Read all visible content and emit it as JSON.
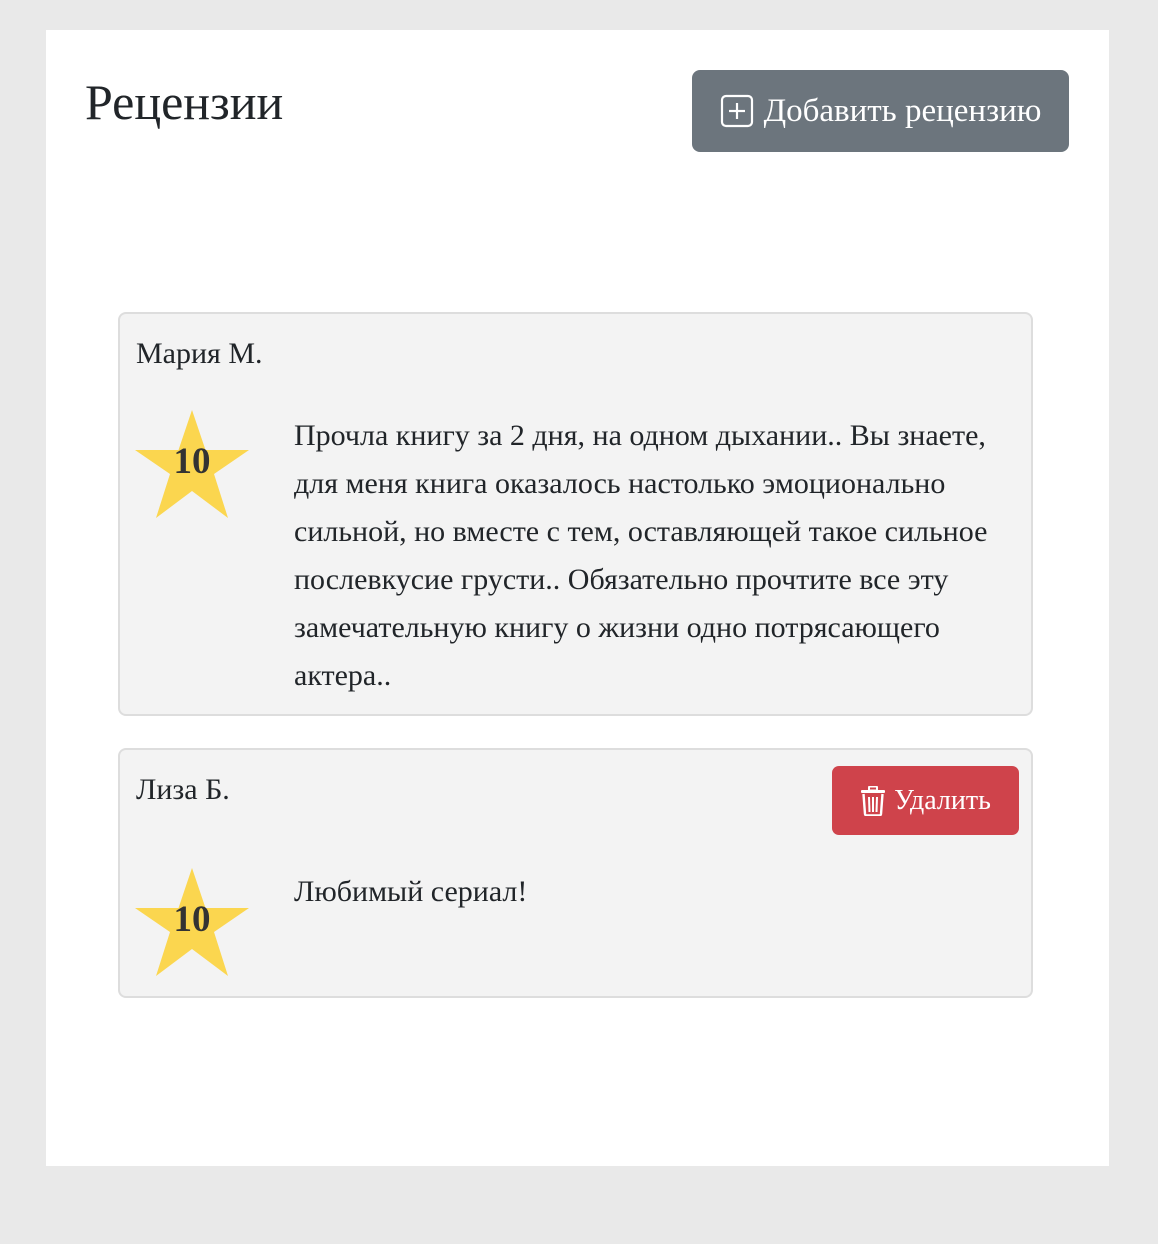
{
  "header": {
    "title": "Рецензии",
    "add_button_label": "Добавить рецензию",
    "add_icon": "plus-square-icon",
    "add_button_color": "#6c757d"
  },
  "reviews": [
    {
      "author": "Мария М.",
      "rating": "10",
      "text": "Прочла книгу за 2 дня, на одном дыхании.. Вы знаете, для меня книга оказалось настолько эмоционально сильной, но вместе с тем, оставляющей такое сильное послевкусие грусти.. Обязательно прочтите все эту замечательную книгу о жизни одно потрясающего актера..",
      "rating_icon": "star-icon"
    },
    {
      "author": "Лиза Б.",
      "rating": "10",
      "text": "Любимый сериал!",
      "rating_icon": "star-icon",
      "delete_button_label": "Удалить",
      "delete_icon": "trash-icon",
      "delete_button_color": "#cf434b"
    }
  ],
  "colors": {
    "star": "#fbd64f",
    "card_background": "#f3f3f3",
    "page_background": "#e9e9e9"
  }
}
